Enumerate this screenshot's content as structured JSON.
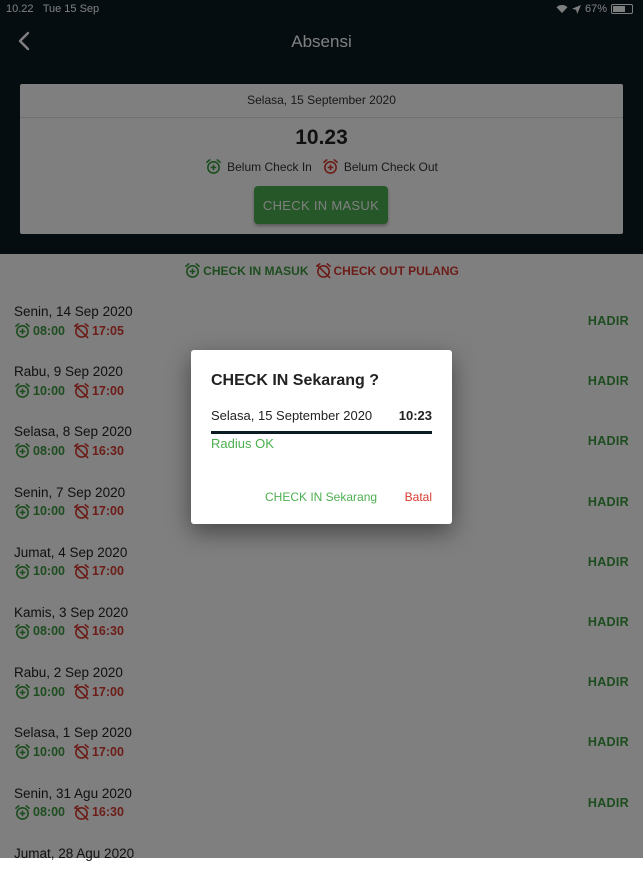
{
  "status_bar": {
    "time": "10.22",
    "date": "Tue 15 Sep",
    "battery": "67%",
    "battery_level": 0.67
  },
  "navbar": {
    "title": "Absensi"
  },
  "today_card": {
    "date": "Selasa, 15 September 2020",
    "time": "10.23",
    "checkin_status": "Belum Check In",
    "checkout_status": "Belum Check Out",
    "button_label": "CHECK IN MASUK"
  },
  "legend": {
    "checkin_label": "CHECK IN MASUK",
    "checkout_label": "CHECK OUT PULANG"
  },
  "attendance": [
    {
      "date": "Senin, 14 Sep 2020",
      "in": "08:00",
      "out": "17:05",
      "status": "HADIR"
    },
    {
      "date": "Rabu, 9 Sep 2020",
      "in": "10:00",
      "out": "17:00",
      "status": "HADIR"
    },
    {
      "date": "Selasa, 8 Sep 2020",
      "in": "08:00",
      "out": "16:30",
      "status": "HADIR"
    },
    {
      "date": "Senin, 7 Sep 2020",
      "in": "10:00",
      "out": "17:00",
      "status": "HADIR"
    },
    {
      "date": "Jumat, 4 Sep 2020",
      "in": "10:00",
      "out": "17:00",
      "status": "HADIR"
    },
    {
      "date": "Kamis, 3 Sep 2020",
      "in": "08:00",
      "out": "16:30",
      "status": "HADIR"
    },
    {
      "date": "Rabu, 2 Sep 2020",
      "in": "10:00",
      "out": "17:00",
      "status": "HADIR"
    },
    {
      "date": "Selasa, 1 Sep 2020",
      "in": "10:00",
      "out": "17:00",
      "status": "HADIR"
    },
    {
      "date": "Senin, 31 Agu 2020",
      "in": "08:00",
      "out": "16:30",
      "status": "HADIR"
    },
    {
      "date": "Jumat, 28 Agu 2020",
      "in": "",
      "out": "",
      "status": ""
    }
  ],
  "dialog": {
    "title": "CHECK IN Sekarang ?",
    "date": "Selasa, 15 September 2020",
    "time": "10:23",
    "radius_status": "Radius OK",
    "confirm_label": "CHECK IN Sekarang",
    "cancel_label": "Batal"
  },
  "colors": {
    "primary_dark": "#0b1b22",
    "green": "#4caf50",
    "red": "#d93b30"
  },
  "icons": {
    "checkin": "alarm-add-icon",
    "checkout": "alarm-off-icon",
    "back": "chevron-left-icon"
  }
}
